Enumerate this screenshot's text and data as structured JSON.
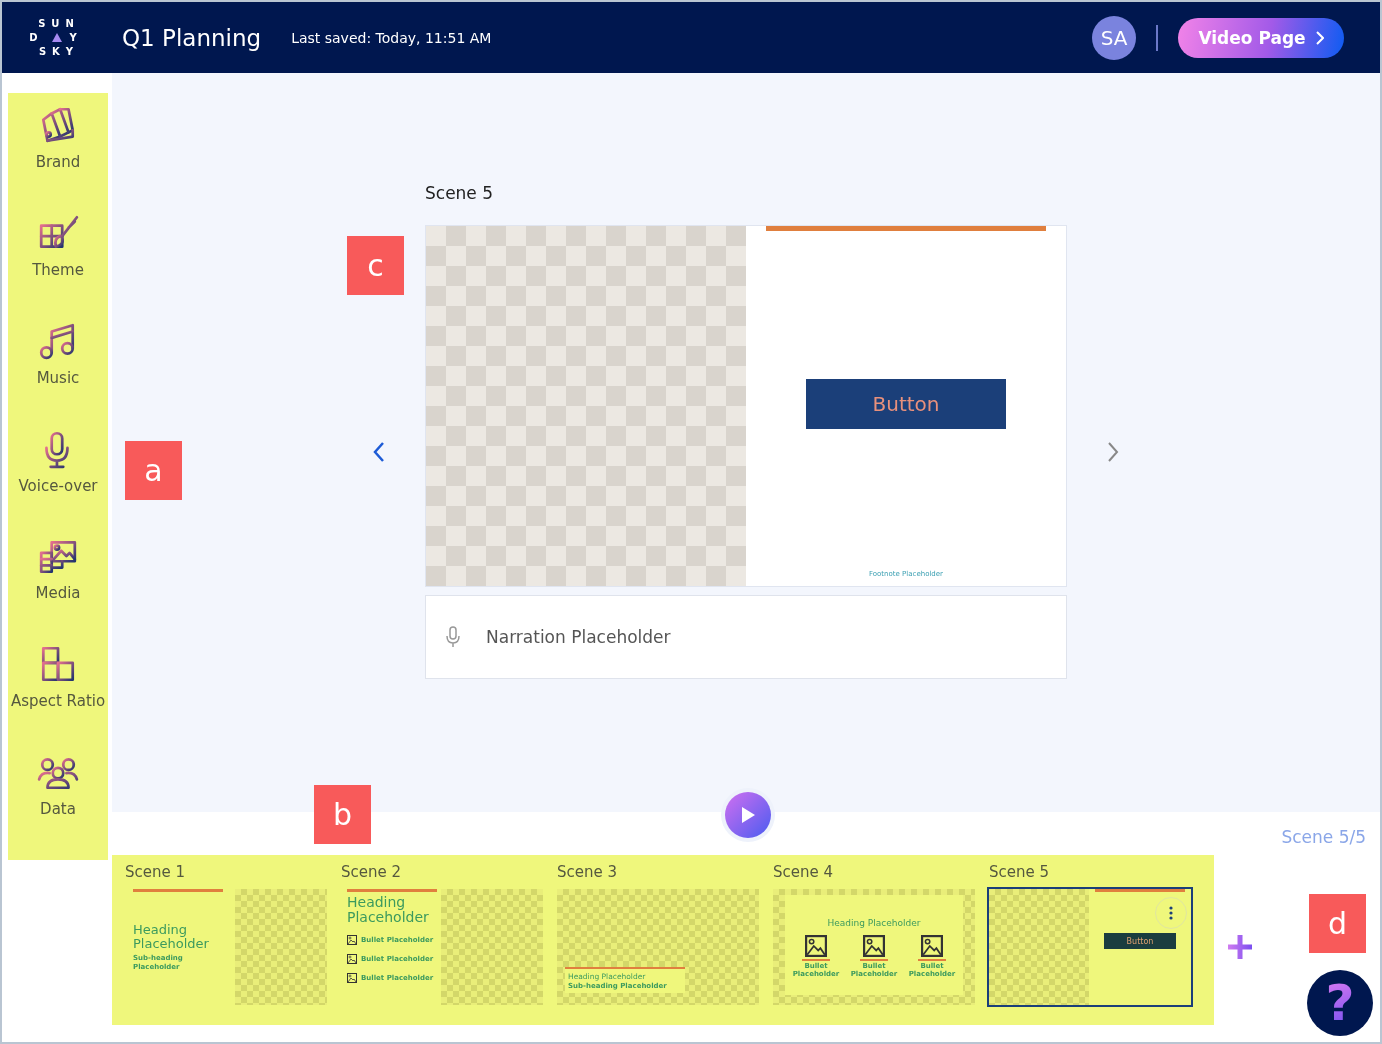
{
  "header": {
    "logo": {
      "top": "SUN",
      "middle_left": "D",
      "middle_right": "Y",
      "bottom": "SKY"
    },
    "title": "Q1 Planning",
    "last_saved": "Last saved: Today, 11:51 AM",
    "avatar": "SA",
    "video_page_button": "Video Page"
  },
  "sidebar": {
    "items": [
      {
        "label": "Brand"
      },
      {
        "label": "Theme"
      },
      {
        "label": "Music"
      },
      {
        "label": "Voice-over"
      },
      {
        "label": "Media"
      },
      {
        "label": "Aspect Ratio"
      },
      {
        "label": "Data"
      }
    ]
  },
  "editor": {
    "scene_title": "Scene 5",
    "preview": {
      "button": "Button",
      "footnote": "Footnote Placeholder"
    },
    "narration": {
      "placeholder": "Narration Placeholder"
    }
  },
  "timeline": {
    "counter": "Scene 5/5",
    "scenes": [
      {
        "label": "Scene 1",
        "kind": "title",
        "selected": false,
        "heading": "Heading Placeholder",
        "subheading": "Sub-heading Placeholder"
      },
      {
        "label": "Scene 2",
        "kind": "bullets",
        "selected": false,
        "heading": "Heading Placeholder",
        "bullets": [
          "Bullet Placeholder",
          "Bullet Placeholder",
          "Bullet Placeholder"
        ]
      },
      {
        "label": "Scene 3",
        "kind": "overlay",
        "selected": false,
        "heading": "Heading Placeholder",
        "subheading": "Sub-heading Placeholder"
      },
      {
        "label": "Scene 4",
        "kind": "columns",
        "selected": false,
        "heading": "Heading Placeholder",
        "bullets": [
          "Bullet Placeholder",
          "Bullet Placeholder",
          "Bullet Placeholder"
        ]
      },
      {
        "label": "Scene 5",
        "kind": "button",
        "selected": true,
        "button": "Button"
      }
    ]
  },
  "help_button": "?",
  "callouts": [
    {
      "label": "a"
    },
    {
      "label": "b"
    },
    {
      "label": "c"
    },
    {
      "label": "d"
    }
  ]
}
